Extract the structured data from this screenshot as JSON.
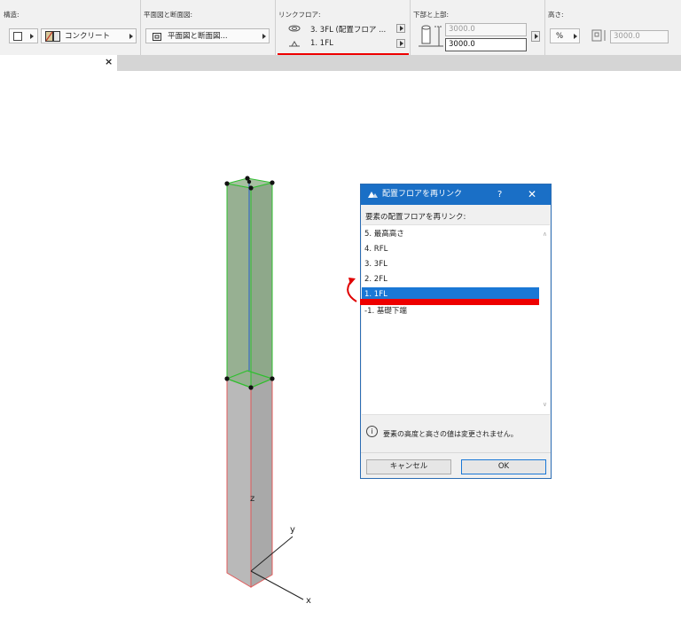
{
  "toolbar": {
    "structure": {
      "label": "構造:",
      "material": "コンクリート"
    },
    "floorplan": {
      "label": "平面図と断面図:",
      "value": "平面図と断面図..."
    },
    "link_floor": {
      "label": "リンクフロア:",
      "top": "3. 3FL (配置フロア ...",
      "bottom": "1. 1FL"
    },
    "bottom_top": {
      "label": "下部と上部:",
      "top_value": "3000.0",
      "bottom_value": "3000.0"
    },
    "height": {
      "label": "高さ:",
      "value": "3000.0",
      "percent": "%"
    }
  },
  "tab": {
    "close": "×"
  },
  "dialog": {
    "title": "配置フロアを再リンク",
    "help": "?",
    "close": "✕",
    "prompt": "要素の配置フロアを再リンク:",
    "items": [
      "5. 最高高さ",
      "4. RFL",
      "3. 3FL",
      "2. 2FL",
      "1. 1FL",
      "-1. 基礎下端"
    ],
    "selected_index": 4,
    "info": "要素の高度と高さの値は変更されません。",
    "cancel": "キャンセル",
    "ok": "OK"
  },
  "axes": {
    "x": "x",
    "y": "y",
    "z": "z"
  },
  "colors": {
    "accent": "#1a78d6",
    "highlight_red": "#ee0000",
    "selection_green": "#2fbf2f"
  }
}
